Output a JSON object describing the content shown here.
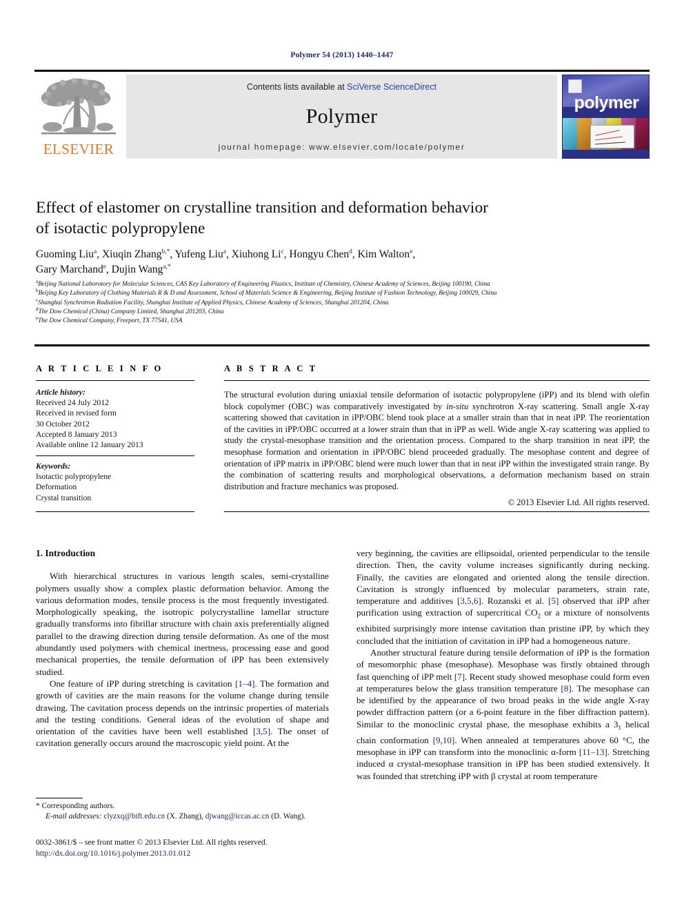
{
  "running_head": "Polymer 54 (2013) 1440–1447",
  "journal_header": {
    "contents_prefix": "Contents lists available at ",
    "sciencedirect": "SciVerse ScienceDirect",
    "journal_name": "Polymer",
    "homepage": "journal homepage: www.elsevier.com/locate/polymer",
    "publisher_logo_text": "ELSEVIER",
    "cover_title": "polymer",
    "colors": {
      "elsevier_orange": "#e87722",
      "link_blue": "#2b3f9e",
      "cover_navy": "#2b2f85",
      "reference_blue": "#1b2a6b",
      "band_grey": "#e6e6e6"
    }
  },
  "article": {
    "title_line1": "Effect of elastomer on crystalline transition and deformation behavior",
    "title_line2": "of isotactic polypropylene",
    "authors": [
      {
        "name": "Guoming Liu",
        "sup": "a"
      },
      {
        "name": "Xiuqin Zhang",
        "sup": "b,*"
      },
      {
        "name": "Yufeng Liu",
        "sup": "a"
      },
      {
        "name": "Xiuhong Li",
        "sup": "c"
      },
      {
        "name": "Hongyu Chen",
        "sup": "d"
      },
      {
        "name": "Kim Walton",
        "sup": "e"
      },
      {
        "name": "Gary Marchand",
        "sup": "e"
      },
      {
        "name": "Dujin Wang",
        "sup": "a,*"
      }
    ],
    "affiliations": [
      {
        "mark": "a",
        "text": "Beijing National Laboratory for Molecular Sciences, CAS Key Laboratory of Engineering Plastics, Institute of Chemistry, Chinese Academy of Sciences, Beijing 100190, China"
      },
      {
        "mark": "b",
        "text": "Beijing Key Laboratory of Clothing Materials R & D and Assessment, School of Materials Science & Engineering, Beijing Institute of Fashion Technology, Beijing 100029, China"
      },
      {
        "mark": "c",
        "text": "Shanghai Synchrotron Radiation Facility, Shanghai Institute of Applied Physics, Chinese Academy of Sciences, Shanghai 201204, China"
      },
      {
        "mark": "d",
        "text": "The Dow Chemical (China) Company Limited, Shanghai 201203, China"
      },
      {
        "mark": "e",
        "text": "The Dow Chemical Company, Freeport, TX 77541, USA"
      }
    ]
  },
  "article_info": {
    "heading": "A R T I C L E   I N F O",
    "history_label": "Article history:",
    "history": [
      "Received 24 July 2012",
      "Received in revised form",
      "30 October 2012",
      "Accepted 8 January 2013",
      "Available online 12 January 2013"
    ],
    "keywords_label": "Keywords:",
    "keywords": [
      "Isotactic polypropylene",
      "Deformation",
      "Crystal transition"
    ]
  },
  "abstract": {
    "heading": "A B S T R A C T",
    "body_part1": "The structural evolution during uniaxial tensile deformation of isotactic polypropylene (iPP) and its blend with olefin block copolymer (OBC) was comparatively investigated by ",
    "italic1": "in-situ",
    "body_part2": " synchrotron X-ray scattering. Small angle X-ray scattering showed that cavitation in iPP/OBC blend took place at a smaller strain than that in neat iPP. The reorientation of the cavities in iPP/OBC occurred at a lower strain than that in iPP as well. Wide angle X-ray scattering was applied to study the crystal-mesophase transition and the orientation process. Compared to the sharp transition in neat iPP, the mesophase formation and orientation in iPP/OBC blend proceeded gradually. The mesophase content and degree of orientation of iPP matrix in iPP/OBC blend were much lower than that in neat iPP within the investigated strain range. By the combination of scattering results and morphological observations, a deformation mechanism based on strain distribution and fracture mechanics was proposed.",
    "copyright": "© 2013 Elsevier Ltd. All rights reserved."
  },
  "body": {
    "section_number_title": "1. Introduction",
    "left_paragraph_1": "With hierarchical structures in various length scales, semi-crystalline polymers usually show a complex plastic deformation behavior. Among the various deformation modes, tensile process is the most frequently investigated. Morphologically speaking, the isotropic polycrystalline lamellar structure gradually transforms into fibrillar structure with chain axis preferentially aligned parallel to the drawing direction during tensile deformation. As one of the most abundantly used polymers with chemical inertness, processing ease and good mechanical properties, the tensile deformation of iPP has been extensively studied.",
    "left_paragraph_2_a": "One feature of iPP during stretching is cavitation ",
    "left_ref_1": "[1–4]",
    "left_paragraph_2_b": ". The formation and growth of cavities are the main reasons for the volume change during tensile drawing. The cavitation process depends on the intrinsic properties of materials and the testing conditions. General ideas of the evolution of shape and orientation of the cavities have been well established ",
    "left_ref_2": "[3,5]",
    "left_paragraph_2_c": ". The onset of cavitation generally occurs around the macroscopic yield point. At the",
    "right_paragraph_1_a": "very beginning, the cavities are ellipsoidal, oriented perpendicular to the tensile direction. Then, the cavity volume increases significantly during necking. Finally, the cavities are elongated and oriented along the tensile direction. Cavitation is strongly influenced by molecular parameters, strain rate, temperature and additives ",
    "right_ref_1": "[3,5,6]",
    "right_paragraph_1_b": ". Rozanski et al. ",
    "right_ref_2": "[5]",
    "right_paragraph_1_c": " observed that iPP after purification using extraction of supercritical CO",
    "right_sub_1": "2",
    "right_paragraph_1_d": " or a mixture of nonsolvents exhibited surprisingly more intense cavitation than pristine iPP, by which they concluded that the initiation of cavitation in iPP had a homogeneous nature.",
    "right_paragraph_2_a": "Another structural feature during tensile deformation of iPP is the formation of mesomorphic phase (mesophase). Mesophase was firstly obtained through fast quenching of iPP melt ",
    "right_ref_3": "[7]",
    "right_paragraph_2_b": ". Recent study showed mesophase could form even at temperatures below the glass transition temperature ",
    "right_ref_4": "[8]",
    "right_paragraph_2_c": ". The mesophase can be identified by the appearance of two broad peaks in the wide angle X-ray powder diffraction pattern (or a 6-point feature in the fiber diffraction pattern). Similar to the monoclinic crystal phase, the mesophase exhibits a 3",
    "right_sub_2": "1",
    "right_paragraph_2_d": " helical chain conformation ",
    "right_ref_5": "[9,10]",
    "right_paragraph_2_e": ". When annealed at temperatures above 60 °C, the mesophase in iPP can transform into the monoclinic α-form ",
    "right_ref_6": "[11–13]",
    "right_paragraph_2_f": ". Stretching induced α crystal-mesophase transition in iPP has been studied extensively. It was founded that stretching iPP with β crystal at room temperature"
  },
  "footnote": {
    "corresponding": "* Corresponding authors.",
    "email_label": "E-mail addresses:",
    "email1": "clyzxq@bift.edu.cn",
    "email1_owner": " (X. Zhang), ",
    "email2": "djwang@iccas.ac.cn",
    "email2_owner": " (D. Wang)."
  },
  "bottom": {
    "issn_line": "0032-3861/$ – see front matter © 2013 Elsevier Ltd. All rights reserved.",
    "doi": "http://dx.doi.org/10.1016/j.polymer.2013.01.012"
  }
}
